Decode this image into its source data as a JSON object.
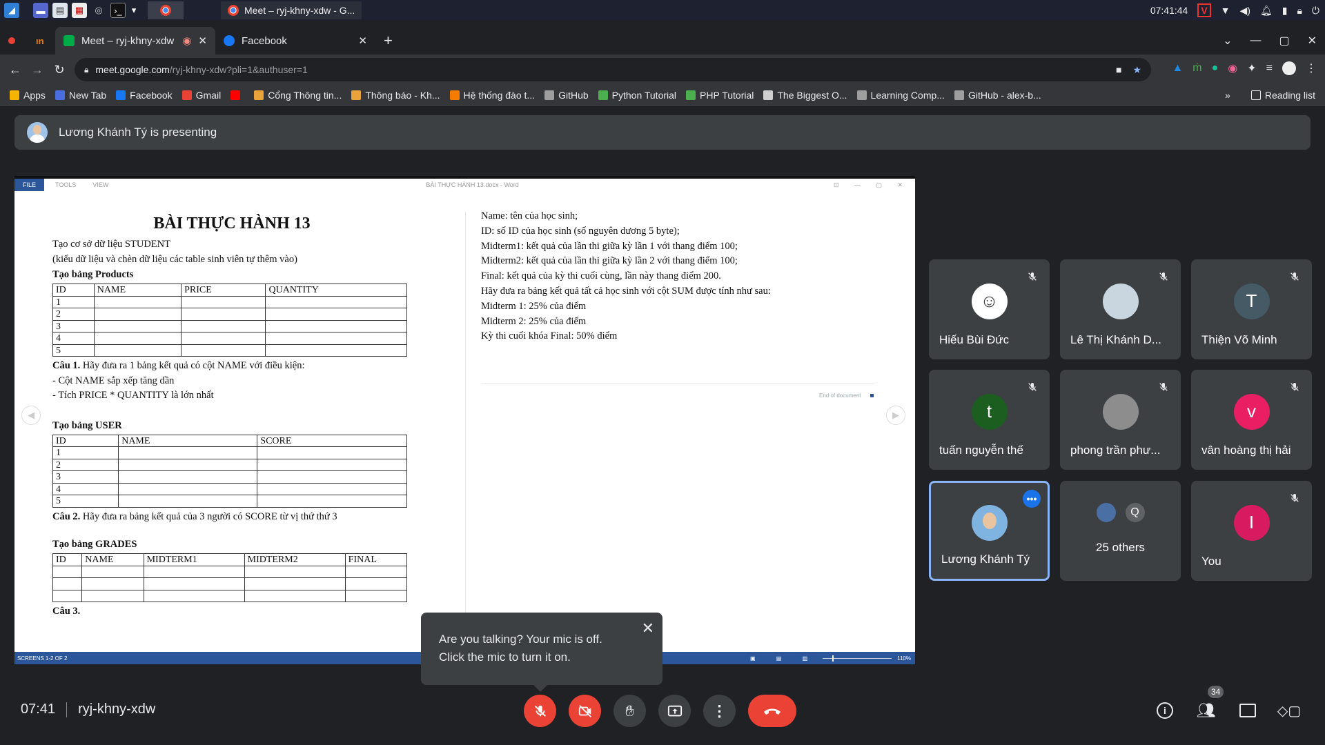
{
  "taskbar": {
    "window_title": "Meet – ryj-khny-xdw - G...",
    "clock": "07:41:44"
  },
  "tabs": [
    {
      "label": "Meet – ryj-khny-xdw",
      "active": true
    },
    {
      "label": "Facebook",
      "active": false
    }
  ],
  "address": {
    "host": "meet.google.com",
    "path": "/ryj-khny-xdw?pli=1&authuser=1"
  },
  "bookmarks": [
    {
      "label": "Apps",
      "color": "#f4b400"
    },
    {
      "label": "New Tab",
      "color": "#4a6ee0"
    },
    {
      "label": "Facebook",
      "color": "#1877f2"
    },
    {
      "label": "Gmail",
      "color": "#ea4335"
    },
    {
      "label": "",
      "color": "#ff0000"
    },
    {
      "label": "Cổng Thông tin...",
      "color": "#e8a33a"
    },
    {
      "label": "Thông báo - Kh...",
      "color": "#e8a33a"
    },
    {
      "label": "Hệ thống đào t...",
      "color": "#f57c00"
    },
    {
      "label": "GitHub",
      "color": "#9e9e9e"
    },
    {
      "label": "Python Tutorial",
      "color": "#4caf50"
    },
    {
      "label": "PHP Tutorial",
      "color": "#4caf50"
    },
    {
      "label": "The Biggest O...",
      "color": "#cfcfcf"
    },
    {
      "label": "Learning Comp...",
      "color": "#9e9e9e"
    },
    {
      "label": "GitHub - alex-b...",
      "color": "#9e9e9e"
    }
  ],
  "reading_list": "Reading list",
  "banner": {
    "text": "Lương Khánh Tý is presenting"
  },
  "word": {
    "menu": [
      "FILE",
      "TOOLS",
      "VIEW"
    ],
    "doc_title": "BÀI THỰC HÀNH 13.docx - Word",
    "status": "SCREENS 1-2 OF 2",
    "zoom": "110%",
    "end_of_document": "End of document"
  },
  "doc": {
    "title": "BÀI THỰC HÀNH 13",
    "line1": "Tạo cơ sở dữ liệu STUDENT",
    "line2": "(kiểu dữ liệu và chèn dữ liệu các table sinh viên tự thêm vào)",
    "products_heading": "Tạo bảng Products",
    "products_headers": [
      "ID",
      "NAME",
      "PRICE",
      "QUANTITY"
    ],
    "products_rows": [
      "1",
      "2",
      "3",
      "4",
      "5"
    ],
    "cau1_label": "Câu 1.",
    "cau1_text": " Hãy đưa ra 1 bảng kết quả có cột NAME với điều kiện:",
    "cau1_b1": "- Cột NAME sắp xếp tăng dần",
    "cau1_b2": "- Tích PRICE * QUANTITY là lớn nhất",
    "user_heading": "Tạo bảng USER",
    "user_headers": [
      "ID",
      "NAME",
      "SCORE"
    ],
    "user_rows": [
      "1",
      "2",
      "3",
      "4",
      "5"
    ],
    "cau2_label": "Câu 2.",
    "cau2_text": " Hãy đưa ra bảng kết quả của 3 người có SCORE từ vị thứ thứ 3",
    "grades_heading": "Tạo bảng GRADES",
    "grades_headers": [
      "ID",
      "NAME",
      "MIDTERM1",
      "MIDTERM2",
      "FINAL"
    ],
    "cau3_label": "Câu 3.",
    "right_lines": [
      "Name: tên của học sinh;",
      "ID: số ID của học sinh (số nguyên dương 5 byte);",
      "Midterm1: kết quả của lần thi giữa kỳ lần 1 với thang điểm 100;",
      "Midterm2: kết quả của lần thi giữa kỳ lần 2 với thang điểm 100;",
      "Final: kết quả của kỳ thi cuối cùng, lần này thang điểm 200.",
      "Hãy đưa ra bảng kết quả tất cả học sinh với cột SUM được tính như sau:",
      "Midterm 1: 25% của điểm",
      "Midterm 2: 25% của điểm",
      "Kỳ thi cuối khóa Final: 50% điểm"
    ]
  },
  "participants": [
    {
      "name": "Hiếu Bùi Đức",
      "initial": "",
      "color": "#ffffff",
      "muted": true
    },
    {
      "name": "Lê Thị Khánh D...",
      "initial": "",
      "color": "#c9d6df",
      "muted": true
    },
    {
      "name": "Thiện Võ Minh",
      "initial": "T",
      "color": "#455a64",
      "muted": true
    },
    {
      "name": "tuấn nguyễn thế",
      "initial": "t",
      "color": "#1b5e20",
      "muted": true
    },
    {
      "name": "phong trần phư...",
      "initial": "",
      "color": "#8d8d8d",
      "muted": true
    },
    {
      "name": "vân hoàng thị hải",
      "initial": "v",
      "color": "#e91e63",
      "muted": true
    },
    {
      "name": "Lương Khánh Tý",
      "initial": "",
      "color": "#7fb3e0",
      "muted": false,
      "active": true
    },
    {
      "name": "25 others",
      "initial": "Q",
      "color": "#5f6368",
      "muted": false
    },
    {
      "name": "You",
      "initial": "I",
      "color": "#d81b60",
      "muted": true
    }
  ],
  "toast": {
    "line1": "Are you talking? Your mic is off.",
    "line2": "Click the mic to turn it on."
  },
  "bottom": {
    "time": "07:41",
    "meeting_code": "ryj-khny-xdw",
    "people_count": "34"
  },
  "colors": {
    "accent": "#8ab4f8",
    "danger": "#ea4335",
    "word_blue": "#2b579a"
  }
}
